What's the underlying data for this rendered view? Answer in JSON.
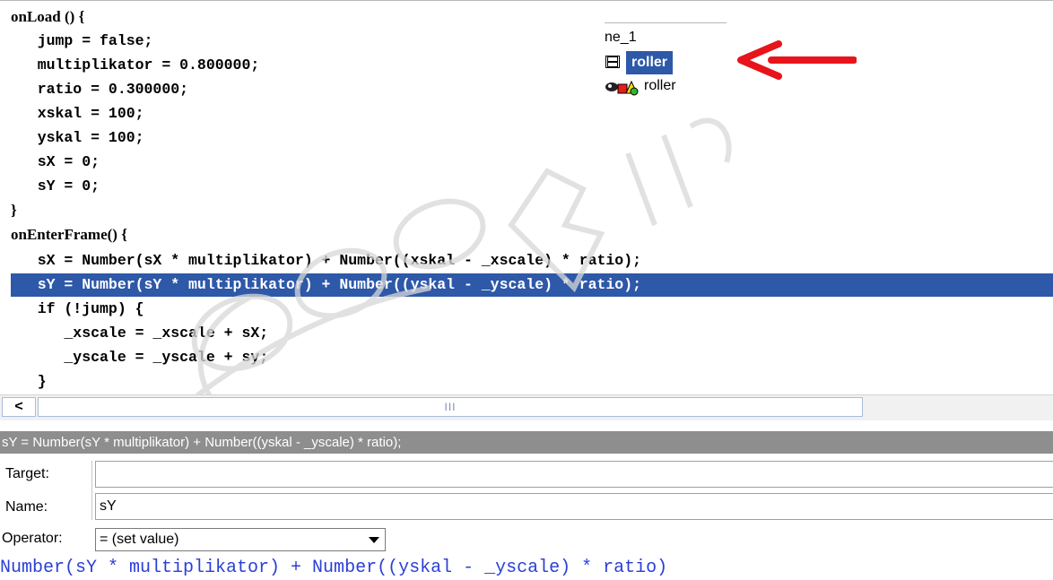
{
  "editor": {
    "lines": [
      "onLoad () {",
      "   jump = false;",
      "   multiplikator = 0.800000;",
      "   ratio = 0.300000;",
      "   xskal = 100;",
      "   yskal = 100;",
      "   sX = 0;",
      "   sY = 0;",
      "}",
      "onEnterFrame() {",
      "   sX = Number(sX * multiplikator) + Number((xskal - _xscale) * ratio);",
      "   sY = Number(sY * multiplikator) + Number((yskal - _yscale) * ratio);",
      "   if (!jump) {",
      "      _xscale = _xscale + sX;",
      "      _yscale = _yscale + sy;",
      "   }"
    ],
    "selected_line": 11
  },
  "outline": {
    "scene_label": "ne_1",
    "selected_item": "roller",
    "child_item": "roller",
    "arrow_color": "#e8141b",
    "film_icon": "movieclip-icon",
    "symbols_icon": "shapes-icon"
  },
  "scrollbar": {
    "left_arrow": "<",
    "thumb_grip": "III"
  },
  "statusbar": {
    "text": "sY = Number(sY * multiplikator) + Number((yskal - _yscale) * ratio);"
  },
  "properties": {
    "target_label": "Target:",
    "target_value": "",
    "name_label": "Name:",
    "name_value": "sY",
    "operator_label": "Operator:",
    "operator_value": "= (set value)",
    "expression": "Number(sY * multiplikator) + Number((yskal - _yscale) * ratio)"
  },
  "colors": {
    "selection": "#2e58a8",
    "expression_text": "#2b3fd6",
    "statusbar_bg": "#8e8e8e"
  }
}
